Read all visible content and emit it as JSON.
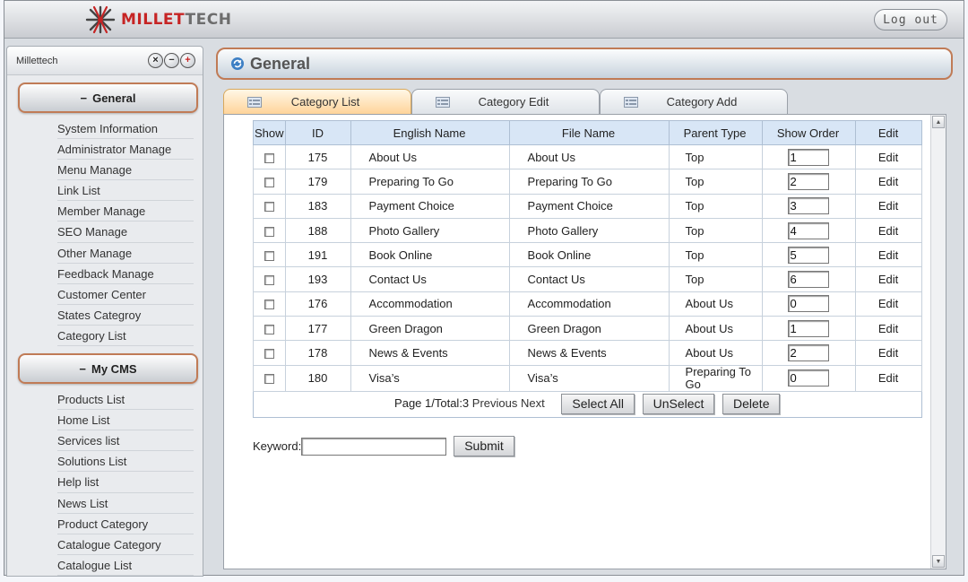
{
  "header": {
    "logo_brand": "MILLETTECH",
    "logo_part_a": "MILLET",
    "logo_part_b": "TECH",
    "logout_label": "Log out"
  },
  "sidebar": {
    "title": "Millettech",
    "controls": [
      "close-icon",
      "minimize-icon",
      "expand-icon"
    ],
    "sections": [
      {
        "label": "General",
        "items": [
          "System Information",
          "Administrator Manage",
          "Menu Manage",
          "Link List",
          "Member Manage",
          "SEO Manage",
          "Other Manage",
          "Feedback Manage",
          "Customer Center",
          "States Categroy",
          "Category List"
        ]
      },
      {
        "label": "My CMS",
        "items": [
          "Products List",
          "Home List",
          "Services list",
          "Solutions List",
          "Help list",
          "News List",
          "Product Category",
          "Catalogue Category",
          "Catalogue List"
        ]
      }
    ]
  },
  "main": {
    "title": "General",
    "tabs": [
      {
        "label": "Category List",
        "active": true
      },
      {
        "label": "Category Edit",
        "active": false
      },
      {
        "label": "Category Add",
        "active": false
      }
    ],
    "table": {
      "columns": [
        "Show",
        "ID",
        "English Name",
        "File Name",
        "Parent Type",
        "Show Order",
        "Edit"
      ],
      "rows": [
        {
          "id": "175",
          "english_name": "About Us",
          "file_name": "About Us",
          "parent_type": "Top",
          "show_order": "1",
          "edit": "Edit"
        },
        {
          "id": "179",
          "english_name": "Preparing To Go",
          "file_name": "Preparing To Go",
          "parent_type": "Top",
          "show_order": "2",
          "edit": "Edit"
        },
        {
          "id": "183",
          "english_name": "Payment Choice",
          "file_name": "Payment Choice",
          "parent_type": "Top",
          "show_order": "3",
          "edit": "Edit"
        },
        {
          "id": "188",
          "english_name": "Photo Gallery",
          "file_name": "Photo Gallery",
          "parent_type": "Top",
          "show_order": "4",
          "edit": "Edit"
        },
        {
          "id": "191",
          "english_name": "Book Online",
          "file_name": "Book Online",
          "parent_type": "Top",
          "show_order": "5",
          "edit": "Edit"
        },
        {
          "id": "193",
          "english_name": "Contact Us",
          "file_name": "Contact Us",
          "parent_type": "Top",
          "show_order": "6",
          "edit": "Edit"
        },
        {
          "id": "176",
          "english_name": "Accommodation",
          "file_name": "Accommodation",
          "parent_type": "About Us",
          "show_order": "0",
          "edit": "Edit"
        },
        {
          "id": "177",
          "english_name": "Green Dragon",
          "file_name": "Green Dragon",
          "parent_type": "About Us",
          "show_order": "1",
          "edit": "Edit"
        },
        {
          "id": "178",
          "english_name": "News & Events",
          "file_name": "News & Events",
          "parent_type": "About Us",
          "show_order": "2",
          "edit": "Edit"
        },
        {
          "id": "180",
          "english_name": "Visa’s",
          "file_name": "Visa’s",
          "parent_type": "Preparing To Go",
          "show_order": "0",
          "edit": "Edit"
        }
      ]
    },
    "pager": {
      "text": "Page 1/Total:3",
      "previous": "Previous",
      "next": "Next"
    },
    "buttons": {
      "select_all": "Select All",
      "unselect": "UnSelect",
      "delete": "Delete"
    },
    "search": {
      "label": "Keyword:",
      "value": "",
      "submit": "Submit"
    }
  },
  "colors": {
    "accent_border": "#c07b56",
    "logo_red": "#c62424",
    "header_cell": "#d8e6f6",
    "active_tab": "#ffd49a"
  }
}
